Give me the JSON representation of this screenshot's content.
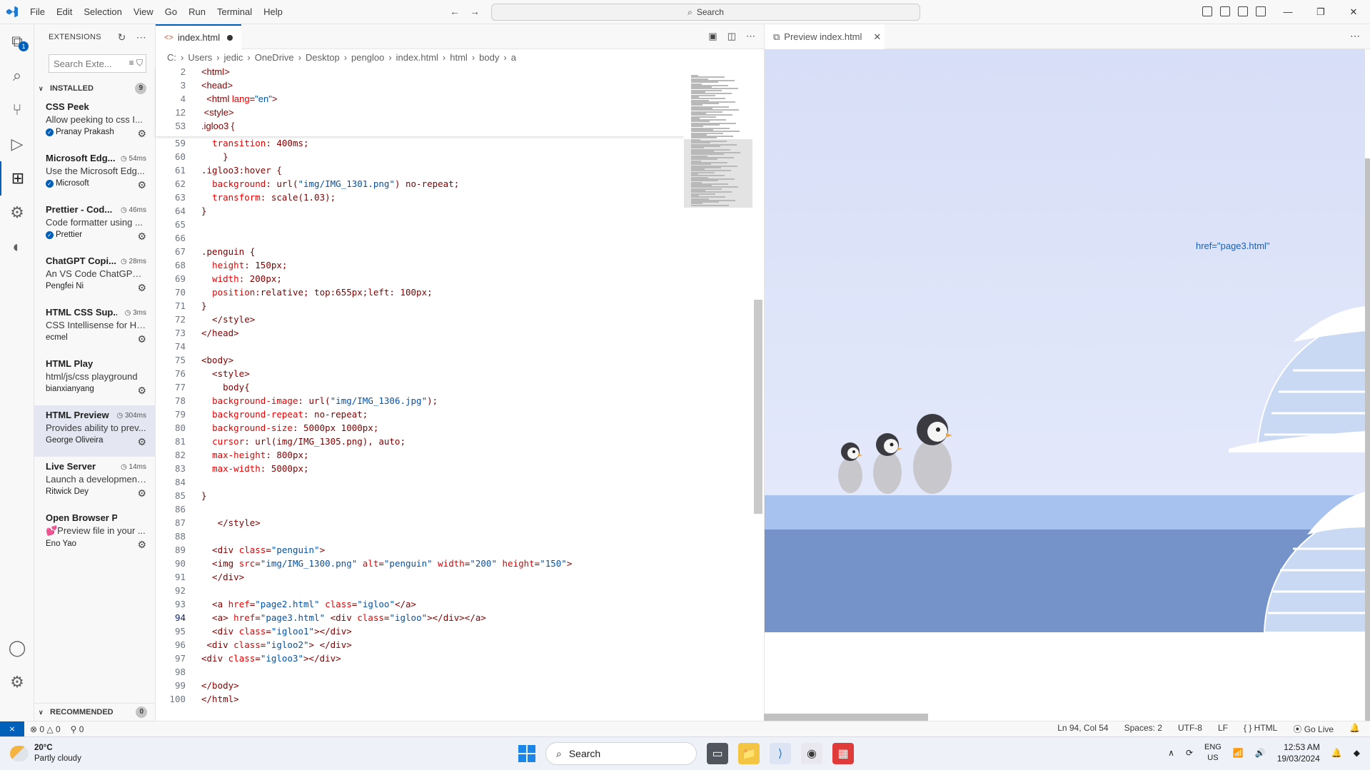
{
  "menu": [
    "File",
    "Edit",
    "Selection",
    "View",
    "Go",
    "Run",
    "Terminal",
    "Help"
  ],
  "command_center": {
    "placeholder": "Search"
  },
  "activity": {
    "extensions_badge": "1"
  },
  "sidebar": {
    "title": "EXTENSIONS",
    "search_placeholder": "Search Exte...",
    "installed_label": "INSTALLED",
    "installed_count": "9",
    "recommended_label": "RECOMMENDED",
    "recommended_count": "0",
    "extensions": [
      {
        "name": "CSS Peek",
        "time": "",
        "desc": "Allow peeking to css I...",
        "publisher": "Pranay Prakash",
        "verified": true
      },
      {
        "name": "Microsoft Edg...",
        "time": "54ms",
        "desc": "Use the Microsoft Edg...",
        "publisher": "Microsoft",
        "verified": true
      },
      {
        "name": "Prettier - Cod...",
        "time": "46ms",
        "desc": "Code formatter using ...",
        "publisher": "Prettier",
        "verified": true
      },
      {
        "name": "ChatGPT Copi...",
        "time": "28ms",
        "desc": "An VS Code ChatGPT ...",
        "publisher": "Pengfei Ni",
        "verified": false
      },
      {
        "name": "HTML CSS Sup...",
        "time": "3ms",
        "desc": "CSS Intellisense for HT...",
        "publisher": "ecmel",
        "verified": false
      },
      {
        "name": "HTML Play",
        "time": "",
        "desc": "html/js/css playground",
        "publisher": "bianxianyang",
        "verified": false
      },
      {
        "name": "HTML Preview",
        "time": "304ms",
        "desc": "Provides ability to prev...",
        "publisher": "George Oliveira",
        "verified": false
      },
      {
        "name": "Live Server",
        "time": "14ms",
        "desc": "Launch a development...",
        "publisher": "Ritwick Dey",
        "verified": false
      },
      {
        "name": "Open Browser Preview",
        "time": "",
        "desc": "💕Preview file in your ...",
        "publisher": "Eno Yao",
        "verified": false
      }
    ]
  },
  "editor": {
    "tab_label": "index.html",
    "breadcrumb": [
      "C:",
      "Users",
      "jedic",
      "OneDrive",
      "Desktop",
      "pengloo",
      "index.html",
      "html",
      "body",
      "a"
    ],
    "sticky_lines": [
      {
        "n": "2",
        "code": "<html>"
      },
      {
        "n": "3",
        "code": "<head>"
      },
      {
        "n": "4",
        "code": "  <html lang=\"en\">"
      },
      {
        "n": "12",
        "code": " <style>"
      },
      {
        "n": "53",
        "code": ".igloo3 {"
      }
    ],
    "lines": [
      {
        "n": "59",
        "code": "  transition: 400ms;"
      },
      {
        "n": "60",
        "code": "    }"
      },
      {
        "n": "61",
        "code": ".igloo3:hover {"
      },
      {
        "n": "62",
        "code": "  background: url(\"img/IMG_1301.png\") no-repeat;"
      },
      {
        "n": "63",
        "code": "  transform: scale(1.03);"
      },
      {
        "n": "64",
        "code": "}"
      },
      {
        "n": "65",
        "code": ""
      },
      {
        "n": "66",
        "code": ""
      },
      {
        "n": "67",
        "code": ".penguin {"
      },
      {
        "n": "68",
        "code": "  height: 150px;"
      },
      {
        "n": "69",
        "code": "  width: 200px;"
      },
      {
        "n": "70",
        "code": "  position:relative; top:655px;left: 100px;"
      },
      {
        "n": "71",
        "code": "}"
      },
      {
        "n": "72",
        "code": "  </style>"
      },
      {
        "n": "73",
        "code": "</head>"
      },
      {
        "n": "74",
        "code": ""
      },
      {
        "n": "75",
        "code": "<body>"
      },
      {
        "n": "76",
        "code": "  <style>"
      },
      {
        "n": "77",
        "code": "    body{"
      },
      {
        "n": "78",
        "code": "  background-image: url(\"img/IMG_1306.jpg\");"
      },
      {
        "n": "79",
        "code": "  background-repeat: no-repeat;"
      },
      {
        "n": "80",
        "code": "  background-size: 5000px 1000px;"
      },
      {
        "n": "81",
        "code": "  cursor: url(img/IMG_1305.png), auto;"
      },
      {
        "n": "82",
        "code": "  max-height: 800px;"
      },
      {
        "n": "83",
        "code": "  max-width: 5000px;"
      },
      {
        "n": "84",
        "code": ""
      },
      {
        "n": "85",
        "code": "}"
      },
      {
        "n": "86",
        "code": ""
      },
      {
        "n": "87",
        "code": "   </style>"
      },
      {
        "n": "88",
        "code": ""
      },
      {
        "n": "89",
        "code": "  <div class=\"penguin\">"
      },
      {
        "n": "90",
        "code": "  <img src=\"img/IMG_1300.png\" alt=\"penguin\" width=\"200\" height=\"150\">"
      },
      {
        "n": "91",
        "code": "  </div>"
      },
      {
        "n": "92",
        "code": ""
      },
      {
        "n": "93",
        "code": "  <a href=\"page2.html\" class=\"igloo\"</a>"
      },
      {
        "n": "94",
        "code": "  <a> href=\"page3.html\" <div class=\"igloo\"></div></a>"
      },
      {
        "n": "95",
        "code": "  <div class=\"igloo1\"></div>"
      },
      {
        "n": "96",
        "code": " <div class=\"igloo2\"> </div>"
      },
      {
        "n": "97",
        "code": "<div class=\"igloo3\"></div>"
      },
      {
        "n": "98",
        "code": ""
      },
      {
        "n": "99",
        "code": "</body>"
      },
      {
        "n": "100",
        "code": "</html>"
      }
    ]
  },
  "preview": {
    "tab_label": "Preview index.html",
    "link_text": "href=\"page3.html\""
  },
  "statusbar": {
    "errors": "0",
    "warnings": "0",
    "ports": "0",
    "position": "Ln 94, Col 54",
    "spaces": "Spaces: 2",
    "encoding": "UTF-8",
    "eol": "LF",
    "language": "HTML",
    "golive": "Go Live"
  },
  "taskbar": {
    "temp": "20°C",
    "weather": "Partly cloudy",
    "search": "Search",
    "lang1": "ENG",
    "lang2": "US",
    "time": "12:53 AM",
    "date": "19/03/2024"
  },
  "colors": {
    "accent": "#005fb8",
    "sky": "#dfe6fb",
    "ice": "#a7c2ee",
    "sea": "#7593c8"
  }
}
